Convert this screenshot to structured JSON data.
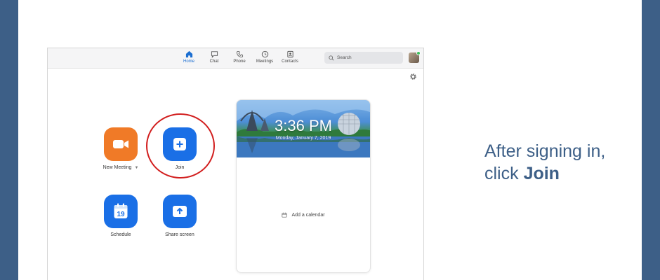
{
  "nav": {
    "items": [
      {
        "label": "Home",
        "icon": "home-icon",
        "active": true
      },
      {
        "label": "Chat",
        "icon": "chat-icon",
        "active": false
      },
      {
        "label": "Phone",
        "icon": "phone-icon",
        "active": false
      },
      {
        "label": "Meetings",
        "icon": "clock-icon",
        "active": false
      },
      {
        "label": "Contacts",
        "icon": "contacts-icon",
        "active": false
      }
    ]
  },
  "search": {
    "placeholder": "Search"
  },
  "actions": {
    "new_meeting": "New Meeting",
    "join": "Join",
    "schedule": "Schedule",
    "schedule_day": "19",
    "share_screen": "Share screen"
  },
  "calendar": {
    "time": "3:36 PM",
    "date": "Monday, January 7, 2019",
    "add_calendar": "Add a calendar"
  },
  "caption": {
    "line1": "After signing in,",
    "line2_prefix": "click ",
    "line2_bold": "Join"
  },
  "colors": {
    "accent_blue": "#1a6fe6",
    "new_meeting_orange": "#f07a27",
    "highlight_red": "#d21f1f",
    "frame_blue": "#3d5f87"
  }
}
